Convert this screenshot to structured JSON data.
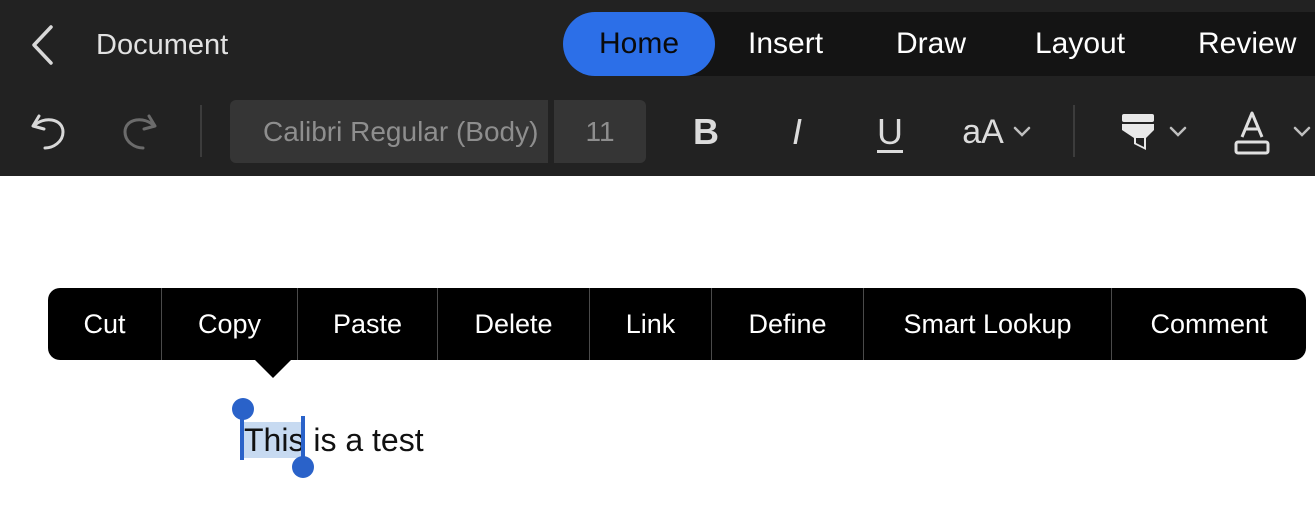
{
  "header": {
    "document_title": "Document",
    "tabs": [
      {
        "label": "Home",
        "active": true
      },
      {
        "label": "Insert",
        "active": false
      },
      {
        "label": "Draw",
        "active": false
      },
      {
        "label": "Layout",
        "active": false
      },
      {
        "label": "Review",
        "active": false
      }
    ]
  },
  "toolbar": {
    "font_name": "Calibri Regular (Body)",
    "font_size": "11",
    "bold": "B",
    "italic": "I",
    "underline": "U",
    "text_size": "aA",
    "icons": [
      "undo-icon",
      "redo-icon",
      "highlighter-icon",
      "font-color-icon",
      "chevron-down-icon"
    ]
  },
  "context_menu": {
    "items": [
      "Cut",
      "Copy",
      "Paste",
      "Delete",
      "Link",
      "Define",
      "Smart Lookup",
      "Comment"
    ]
  },
  "document": {
    "selected_text": "This",
    "rest_text": " is a test"
  },
  "colors": {
    "accent": "#2c6fe8",
    "selection": "#c7daf1",
    "handle": "#2a62c9",
    "bar_bg": "#222222"
  }
}
